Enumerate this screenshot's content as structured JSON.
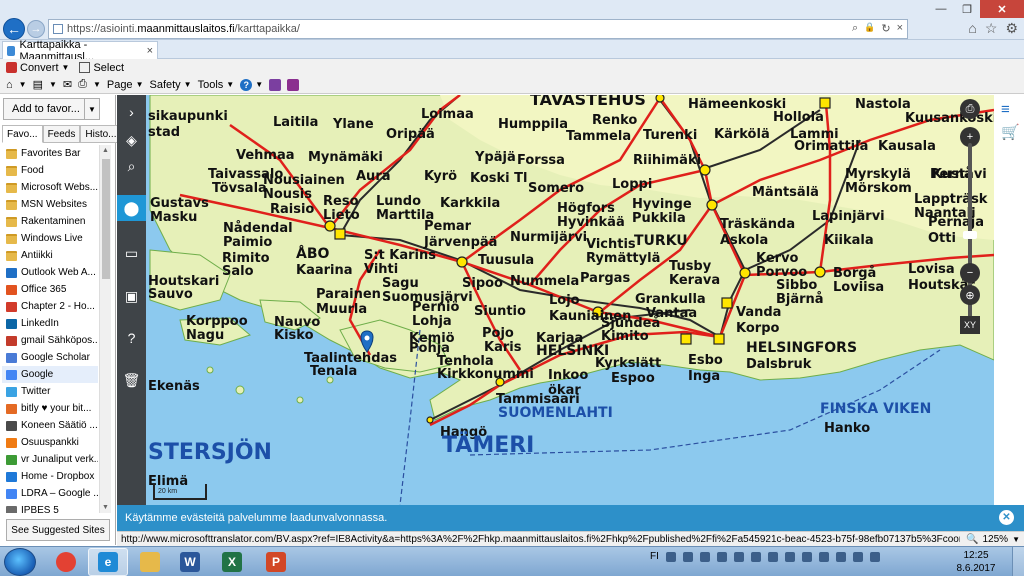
{
  "browser": {
    "url_prefix": "https://asiointi.",
    "url_domain": "maanmittauslaitos.fi",
    "url_path": "/karttapaikka/",
    "tab_title": "Karttapaikka - Maanmittausl...",
    "tab_close": "×",
    "win_min": "—",
    "win_max": "❐",
    "win_close": "✕",
    "addr_search": "⌕",
    "addr_lock": "🔒",
    "addr_refresh": "↻",
    "addr_close": "×"
  },
  "command_bar": {
    "convert_label": "Convert",
    "select_label": "Select",
    "page_label": "Page",
    "safety_label": "Safety",
    "tools_label": "Tools",
    "help_label": "?"
  },
  "favorites": {
    "add_button": "Add to favor...",
    "tabs": [
      "Favo...",
      "Feeds",
      "Histo..."
    ],
    "items": [
      {
        "label": "Favorites Bar",
        "icon": "folder-icon",
        "color": "#e6b94a"
      },
      {
        "label": "Food",
        "icon": "folder-icon",
        "color": "#e6b94a"
      },
      {
        "label": "Microsoft Webs...",
        "icon": "folder-icon",
        "color": "#e6b94a"
      },
      {
        "label": "MSN Websites",
        "icon": "folder-icon",
        "color": "#e6b94a"
      },
      {
        "label": "Rakentaminen",
        "icon": "folder-icon",
        "color": "#e6b94a"
      },
      {
        "label": "Windows Live",
        "icon": "folder-icon",
        "color": "#e6b94a"
      },
      {
        "label": "Antiikki",
        "icon": "folder-icon",
        "color": "#e6b94a"
      },
      {
        "label": "Outlook Web A...",
        "icon": "outlook-icon",
        "color": "#1f6fc5"
      },
      {
        "label": "Office 365",
        "icon": "office-icon",
        "color": "#e2531f"
      },
      {
        "label": "Chapter 2 - Ho...",
        "icon": "page-icon",
        "color": "#d23b2b"
      },
      {
        "label": "LinkedIn",
        "icon": "linkedin-icon",
        "color": "#0b66a6"
      },
      {
        "label": "gmail Sähköpos...",
        "icon": "gmail-icon",
        "color": "#c33b2b"
      },
      {
        "label": "Google Scholar",
        "icon": "scholar-icon",
        "color": "#4a7bd6"
      },
      {
        "label": "Google",
        "icon": "google-icon",
        "color": "#4285f4"
      },
      {
        "label": "Twitter",
        "icon": "twitter-icon",
        "color": "#3aa3e3"
      },
      {
        "label": "bitly ♥ your bit...",
        "icon": "bitly-icon",
        "color": "#e46a24"
      },
      {
        "label": "Koneen Säätiö ...",
        "icon": "page-icon",
        "color": "#4a4a4a"
      },
      {
        "label": "Osuuspankki",
        "icon": "bank-icon",
        "color": "#f07b13"
      },
      {
        "label": "vr Junaliput verk...",
        "icon": "vr-icon",
        "color": "#3d9b35"
      },
      {
        "label": "Home - Dropbox",
        "icon": "dropbox-icon",
        "color": "#1f79d8"
      },
      {
        "label": "LDRA – Google ...",
        "icon": "google-icon",
        "color": "#4285f4"
      },
      {
        "label": "IPBES 5",
        "icon": "page-icon",
        "color": "#6a6a6a"
      }
    ],
    "selected_index": 13,
    "suggested_button": "See Suggested Sites"
  },
  "map": {
    "labels": [
      {
        "text": "TAVASTEHUS",
        "cls": "big"
      },
      {
        "text": "Hämeenkoski"
      },
      {
        "text": "Hollola"
      },
      {
        "text": "Nastola"
      },
      {
        "text": "Kuusankoski"
      },
      {
        "text": "sikaupunki"
      },
      {
        "text": "Laitila"
      },
      {
        "text": "Loimaa"
      },
      {
        "text": "Humppila"
      },
      {
        "text": "Renko"
      },
      {
        "text": "Kärkölä"
      },
      {
        "text": "Lammi"
      },
      {
        "text": "Tammela"
      },
      {
        "text": "Turenki"
      },
      {
        "text": "Orimattila"
      },
      {
        "text": "stad"
      },
      {
        "text": "Ylane"
      },
      {
        "text": "Oripää"
      },
      {
        "text": "Kausala"
      },
      {
        "text": "Vehmaa"
      },
      {
        "text": "Mynämäki"
      },
      {
        "text": "Ypäjä"
      },
      {
        "text": "Forssa"
      },
      {
        "text": "Riihimäki"
      },
      {
        "text": "Taivassalo"
      },
      {
        "text": "Tövsala"
      },
      {
        "text": "Nousiainen"
      },
      {
        "text": "Nousis"
      },
      {
        "text": "Aura"
      },
      {
        "text": "Kyrö"
      },
      {
        "text": "Koski Tl"
      },
      {
        "text": "Somero"
      },
      {
        "text": "Loppi"
      },
      {
        "text": "Mäntsälä"
      },
      {
        "text": "Myrskylä"
      },
      {
        "text": "Mörskom"
      },
      {
        "text": "Kustavi"
      },
      {
        "text": "Gustavs"
      },
      {
        "text": "Masku"
      },
      {
        "text": "Raisio"
      },
      {
        "text": "Reso"
      },
      {
        "text": "Lieto"
      },
      {
        "text": "Lundo"
      },
      {
        "text": "Marttila"
      },
      {
        "text": "Karkkila"
      },
      {
        "text": "Högfors"
      },
      {
        "text": "Hyvinkää"
      },
      {
        "text": "Hyvinge"
      },
      {
        "text": "Pukkila"
      },
      {
        "text": "Lapinjärvi"
      },
      {
        "text": "Lappträsk"
      },
      {
        "text": "Naantali"
      },
      {
        "text": "Nådendal"
      },
      {
        "text": "Paimio"
      },
      {
        "text": "Pemar"
      },
      {
        "text": "Järvenpää"
      },
      {
        "text": "Träskända"
      },
      {
        "text": "Askola"
      },
      {
        "text": "Kiikala"
      },
      {
        "text": "Nurmijärvi"
      },
      {
        "text": "TURKU"
      },
      {
        "text": "ÅBO"
      },
      {
        "text": "Kaarina"
      },
      {
        "text": "S:t Karins"
      },
      {
        "text": "Vihti"
      },
      {
        "text": "Vichtis"
      },
      {
        "text": "Rymättylä"
      },
      {
        "text": "Rimito"
      },
      {
        "text": "Salo"
      },
      {
        "text": "Tuusula"
      },
      {
        "text": "Tusby"
      },
      {
        "text": "Kerava"
      },
      {
        "text": "Kervo"
      },
      {
        "text": "Porvoo"
      },
      {
        "text": "Borgå"
      },
      {
        "text": "Loviisa"
      },
      {
        "text": "Lovisa"
      },
      {
        "text": "Houtskär"
      },
      {
        "text": "Houtskari"
      },
      {
        "text": "Sauvo"
      },
      {
        "text": "Sagu"
      },
      {
        "text": "Suomusjärvi"
      },
      {
        "text": "Nummela"
      },
      {
        "text": "Pargas"
      },
      {
        "text": "Parainen"
      },
      {
        "text": "Muurla"
      },
      {
        "text": "Sipoo"
      },
      {
        "text": "Sibbo"
      },
      {
        "text": "Bjärnå"
      },
      {
        "text": "Perniö"
      },
      {
        "text": "Lohja"
      },
      {
        "text": "Lojo"
      },
      {
        "text": "Kauniainen"
      },
      {
        "text": "Grankulla"
      },
      {
        "text": "Vantaa"
      },
      {
        "text": "Vanda"
      },
      {
        "text": "Korpo"
      },
      {
        "text": "Korppoo"
      },
      {
        "text": "Nagu"
      },
      {
        "text": "Nauvo"
      },
      {
        "text": "Kisko"
      },
      {
        "text": "Siuntio"
      },
      {
        "text": "Sjundeå"
      },
      {
        "text": "Kimito"
      },
      {
        "text": "Kemiö"
      },
      {
        "text": "Pohja"
      },
      {
        "text": "Pojo"
      },
      {
        "text": "Karis"
      },
      {
        "text": "Karjaa"
      },
      {
        "text": "HELSINKI"
      },
      {
        "text": "HELSINGFORS"
      },
      {
        "text": "Dalsbruk"
      },
      {
        "text": "Taalintehdas"
      },
      {
        "text": "Tenala"
      },
      {
        "text": "Tenhola"
      },
      {
        "text": "Kirkkonummi"
      },
      {
        "text": "Kyrkslätt"
      },
      {
        "text": "Espoo"
      },
      {
        "text": "Esbo"
      },
      {
        "text": "Inga"
      },
      {
        "text": "Inkoo"
      },
      {
        "text": "ökar"
      },
      {
        "text": "Ekenäs"
      },
      {
        "text": "Tammisaari"
      },
      {
        "text": "SUOMENLAHTI"
      },
      {
        "text": "FINSKA VIKEN"
      },
      {
        "text": "Hanko"
      },
      {
        "text": "Hangö"
      },
      {
        "text": "TÄMERI"
      },
      {
        "text": "STERSJÖN"
      },
      {
        "text": "Elimä"
      },
      {
        "text": "Pernå"
      },
      {
        "text": "Pernaja"
      },
      {
        "text": "Otti"
      }
    ],
    "scale_label": "20 km",
    "xy_label": "XY",
    "colors": {
      "sea": "#8cc9ee",
      "land": "#e6f0b8",
      "north_land": "#f2f6c2",
      "road": "#e0201b",
      "rail": "#2a2a2a",
      "water_text": "#1c4fa8",
      "pin": "#1f6fc5"
    }
  },
  "cookie": {
    "text": "Käytämme evästeitä palvelumme laadunvalvonnassa.",
    "close": "✕"
  },
  "status": {
    "url": "http://www.microsofttranslator.com/BV.aspx?ref=IE8Activity&a=https%3A%2F%2Fhkp.maanmittauslaitos.fi%2Fhkp%2Fpublished%2Ffi%2Fa545921c-beac-4523-b75f-98efb07137b5%3Fcoord%3E",
    "zoom": "125%"
  },
  "taskbar": {
    "lang": "FI",
    "time": "12:25",
    "date": "8.6.2017",
    "apps": [
      {
        "name": "chrome-taskbar-app",
        "label": "",
        "color": "#e34133"
      },
      {
        "name": "ie-taskbar-app",
        "label": "e",
        "color": "#1f8ad6"
      },
      {
        "name": "explorer-taskbar-app",
        "label": "",
        "color": "#e6b94a"
      },
      {
        "name": "word-taskbar-app",
        "label": "W",
        "color": "#2b579a"
      },
      {
        "name": "excel-taskbar-app",
        "label": "X",
        "color": "#217346"
      },
      {
        "name": "powerpoint-taskbar-app",
        "label": "P",
        "color": "#d24726"
      }
    ]
  }
}
